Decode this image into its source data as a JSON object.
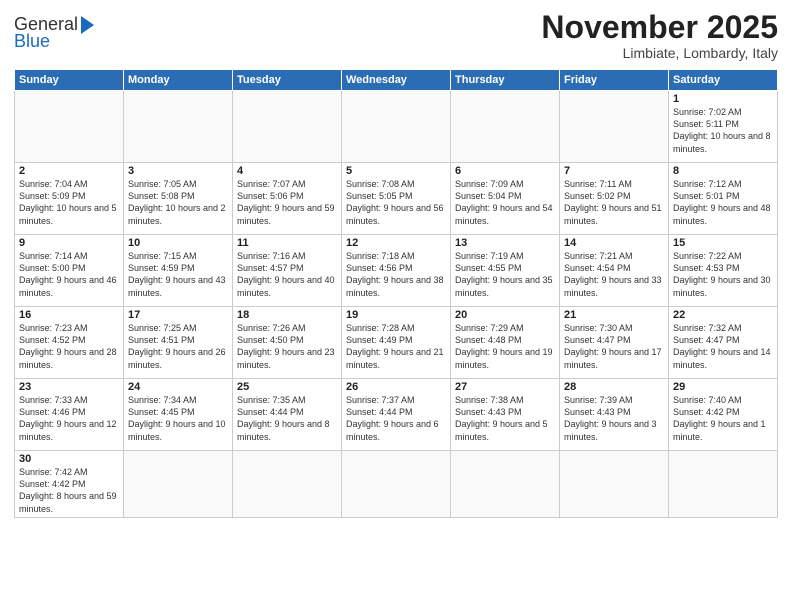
{
  "header": {
    "logo_general": "General",
    "logo_blue": "Blue",
    "month": "November 2025",
    "location": "Limbiate, Lombardy, Italy"
  },
  "days_of_week": [
    "Sunday",
    "Monday",
    "Tuesday",
    "Wednesday",
    "Thursday",
    "Friday",
    "Saturday"
  ],
  "weeks": [
    {
      "days": [
        {
          "num": "",
          "info": ""
        },
        {
          "num": "",
          "info": ""
        },
        {
          "num": "",
          "info": ""
        },
        {
          "num": "",
          "info": ""
        },
        {
          "num": "",
          "info": ""
        },
        {
          "num": "",
          "info": ""
        },
        {
          "num": "1",
          "info": "Sunrise: 7:02 AM\nSunset: 5:11 PM\nDaylight: 10 hours and 8 minutes."
        }
      ]
    },
    {
      "days": [
        {
          "num": "2",
          "info": "Sunrise: 7:04 AM\nSunset: 5:09 PM\nDaylight: 10 hours and 5 minutes."
        },
        {
          "num": "3",
          "info": "Sunrise: 7:05 AM\nSunset: 5:08 PM\nDaylight: 10 hours and 2 minutes."
        },
        {
          "num": "4",
          "info": "Sunrise: 7:07 AM\nSunset: 5:06 PM\nDaylight: 9 hours and 59 minutes."
        },
        {
          "num": "5",
          "info": "Sunrise: 7:08 AM\nSunset: 5:05 PM\nDaylight: 9 hours and 56 minutes."
        },
        {
          "num": "6",
          "info": "Sunrise: 7:09 AM\nSunset: 5:04 PM\nDaylight: 9 hours and 54 minutes."
        },
        {
          "num": "7",
          "info": "Sunrise: 7:11 AM\nSunset: 5:02 PM\nDaylight: 9 hours and 51 minutes."
        },
        {
          "num": "8",
          "info": "Sunrise: 7:12 AM\nSunset: 5:01 PM\nDaylight: 9 hours and 48 minutes."
        }
      ]
    },
    {
      "days": [
        {
          "num": "9",
          "info": "Sunrise: 7:14 AM\nSunset: 5:00 PM\nDaylight: 9 hours and 46 minutes."
        },
        {
          "num": "10",
          "info": "Sunrise: 7:15 AM\nSunset: 4:59 PM\nDaylight: 9 hours and 43 minutes."
        },
        {
          "num": "11",
          "info": "Sunrise: 7:16 AM\nSunset: 4:57 PM\nDaylight: 9 hours and 40 minutes."
        },
        {
          "num": "12",
          "info": "Sunrise: 7:18 AM\nSunset: 4:56 PM\nDaylight: 9 hours and 38 minutes."
        },
        {
          "num": "13",
          "info": "Sunrise: 7:19 AM\nSunset: 4:55 PM\nDaylight: 9 hours and 35 minutes."
        },
        {
          "num": "14",
          "info": "Sunrise: 7:21 AM\nSunset: 4:54 PM\nDaylight: 9 hours and 33 minutes."
        },
        {
          "num": "15",
          "info": "Sunrise: 7:22 AM\nSunset: 4:53 PM\nDaylight: 9 hours and 30 minutes."
        }
      ]
    },
    {
      "days": [
        {
          "num": "16",
          "info": "Sunrise: 7:23 AM\nSunset: 4:52 PM\nDaylight: 9 hours and 28 minutes."
        },
        {
          "num": "17",
          "info": "Sunrise: 7:25 AM\nSunset: 4:51 PM\nDaylight: 9 hours and 26 minutes."
        },
        {
          "num": "18",
          "info": "Sunrise: 7:26 AM\nSunset: 4:50 PM\nDaylight: 9 hours and 23 minutes."
        },
        {
          "num": "19",
          "info": "Sunrise: 7:28 AM\nSunset: 4:49 PM\nDaylight: 9 hours and 21 minutes."
        },
        {
          "num": "20",
          "info": "Sunrise: 7:29 AM\nSunset: 4:48 PM\nDaylight: 9 hours and 19 minutes."
        },
        {
          "num": "21",
          "info": "Sunrise: 7:30 AM\nSunset: 4:47 PM\nDaylight: 9 hours and 17 minutes."
        },
        {
          "num": "22",
          "info": "Sunrise: 7:32 AM\nSunset: 4:47 PM\nDaylight: 9 hours and 14 minutes."
        }
      ]
    },
    {
      "days": [
        {
          "num": "23",
          "info": "Sunrise: 7:33 AM\nSunset: 4:46 PM\nDaylight: 9 hours and 12 minutes."
        },
        {
          "num": "24",
          "info": "Sunrise: 7:34 AM\nSunset: 4:45 PM\nDaylight: 9 hours and 10 minutes."
        },
        {
          "num": "25",
          "info": "Sunrise: 7:35 AM\nSunset: 4:44 PM\nDaylight: 9 hours and 8 minutes."
        },
        {
          "num": "26",
          "info": "Sunrise: 7:37 AM\nSunset: 4:44 PM\nDaylight: 9 hours and 6 minutes."
        },
        {
          "num": "27",
          "info": "Sunrise: 7:38 AM\nSunset: 4:43 PM\nDaylight: 9 hours and 5 minutes."
        },
        {
          "num": "28",
          "info": "Sunrise: 7:39 AM\nSunset: 4:43 PM\nDaylight: 9 hours and 3 minutes."
        },
        {
          "num": "29",
          "info": "Sunrise: 7:40 AM\nSunset: 4:42 PM\nDaylight: 9 hours and 1 minute."
        }
      ]
    },
    {
      "days": [
        {
          "num": "30",
          "info": "Sunrise: 7:42 AM\nSunset: 4:42 PM\nDaylight: 8 hours and 59 minutes."
        },
        {
          "num": "",
          "info": ""
        },
        {
          "num": "",
          "info": ""
        },
        {
          "num": "",
          "info": ""
        },
        {
          "num": "",
          "info": ""
        },
        {
          "num": "",
          "info": ""
        },
        {
          "num": "",
          "info": ""
        }
      ]
    }
  ]
}
